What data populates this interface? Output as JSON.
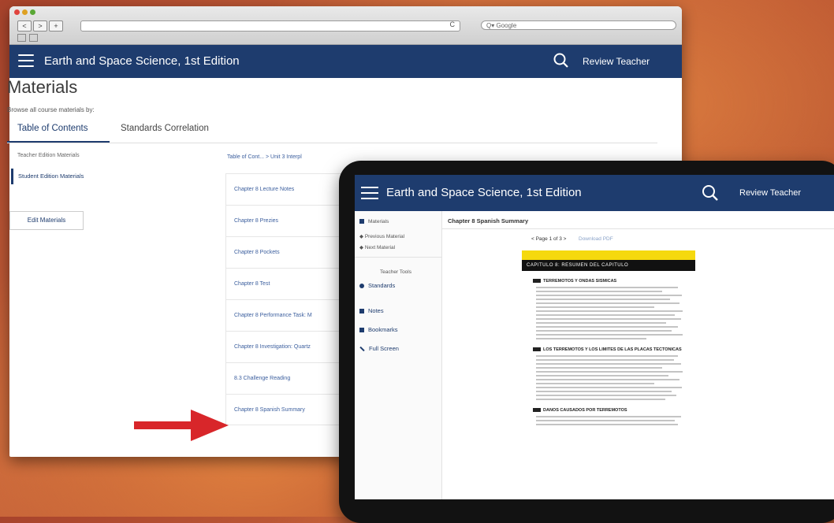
{
  "browser": {
    "search_placeholder": "Google",
    "reload_glyph": "C",
    "back_glyph": "<",
    "forward_glyph": ">",
    "add_glyph": "+"
  },
  "app": {
    "title": "Earth and Space Science, 1st Edition",
    "user": "Review Teacher",
    "accent_color": "#1e3c6e"
  },
  "page": {
    "title": "Materials",
    "browse_label": "Browse all course materials by:",
    "tabs": [
      "Table of Contents",
      "Standards Correlation"
    ],
    "sidebar": [
      "Teacher Edition Materials",
      "Student Edition Materials"
    ],
    "edit_button": "Edit Materials",
    "breadcrumb": "Table of Cont...   >   Unit 3 Interpl",
    "chapters": [
      "Chapter 8 Lecture Notes",
      "Chapter 8 Prezies",
      "Chapter 8 Pockets",
      "Chapter 8 Test",
      "Chapter 8 Performance Task: M",
      "Chapter 8 Investigation: Quartz",
      "8.3 Challenge Reading",
      "Chapter 8 Spanish Summary"
    ]
  },
  "tablet": {
    "title": "Earth and Space Science, 1st Edition",
    "user": "Review Teacher",
    "sidebar": {
      "materials": "Materials",
      "previous": "Previous Material",
      "next": "Next Material",
      "teacher_tools": "Teacher Tools",
      "standards": "Standards",
      "notes": "Notes",
      "bookmarks": "Bookmarks",
      "full_screen": "Full Screen"
    },
    "main_title": "Chapter 8 Spanish Summary",
    "pager": "< Page 1 of 3 >",
    "download": "Download PDF",
    "doc_header": "CAPITULO 8: RESUMEN DEL CAPITULO",
    "sections": [
      "TERREMOTOS Y ONDAS SISMICAS",
      "LOS TERREMOTOS Y LOS LIMITES DE LAS PLACAS TECTONICAS",
      "DANOS CAUSADOS POR TERREMOTOS"
    ]
  }
}
